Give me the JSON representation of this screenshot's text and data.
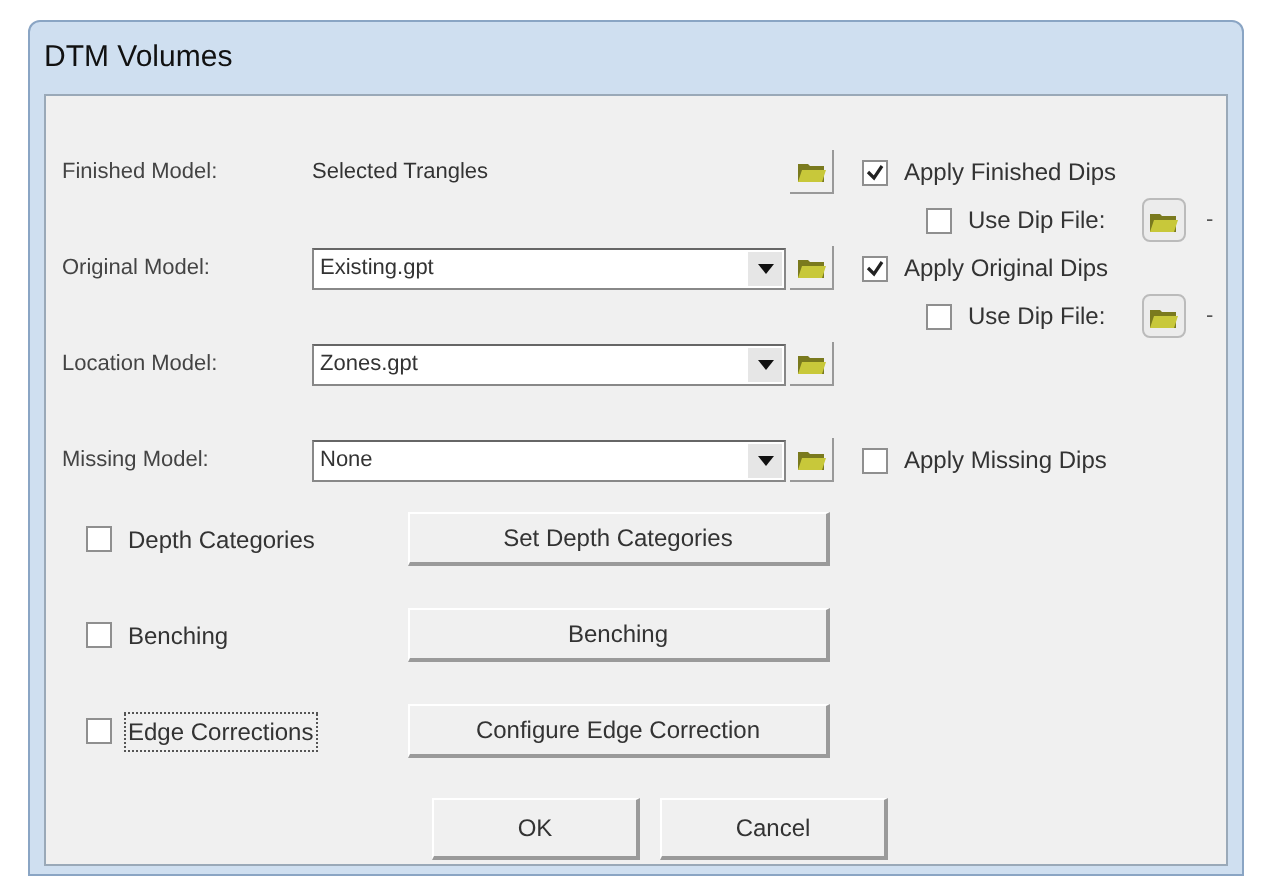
{
  "window": {
    "title": "DTM Volumes"
  },
  "models": [
    {
      "label": "Finished Model:",
      "kind": "text",
      "value": "Selected Trangles",
      "dips": {
        "label": "Apply Finished Dips",
        "checked": true
      },
      "dip_file": {
        "label": "Use Dip File:",
        "checked": false,
        "suffix": "-"
      }
    },
    {
      "label": "Original Model:",
      "kind": "combo",
      "value": "Existing.gpt",
      "dips": {
        "label": "Apply Original Dips",
        "checked": true
      },
      "dip_file": {
        "label": "Use Dip File:",
        "checked": false,
        "suffix": "-"
      }
    },
    {
      "label": "Location Model:",
      "kind": "combo",
      "value": "Zones.gpt"
    },
    {
      "label": "Missing Model:",
      "kind": "combo",
      "value": "None",
      "dips": {
        "label": "Apply Missing Dips",
        "checked": false
      }
    }
  ],
  "options": [
    {
      "label": "Depth Categories",
      "checked": false,
      "focused": false,
      "button": "Set Depth Categories"
    },
    {
      "label": "Benching",
      "checked": false,
      "focused": false,
      "button": "Benching"
    },
    {
      "label": "Edge Corrections",
      "checked": false,
      "focused": true,
      "button": "Configure Edge Correction"
    }
  ],
  "buttons": [
    "OK",
    "Cancel"
  ]
}
